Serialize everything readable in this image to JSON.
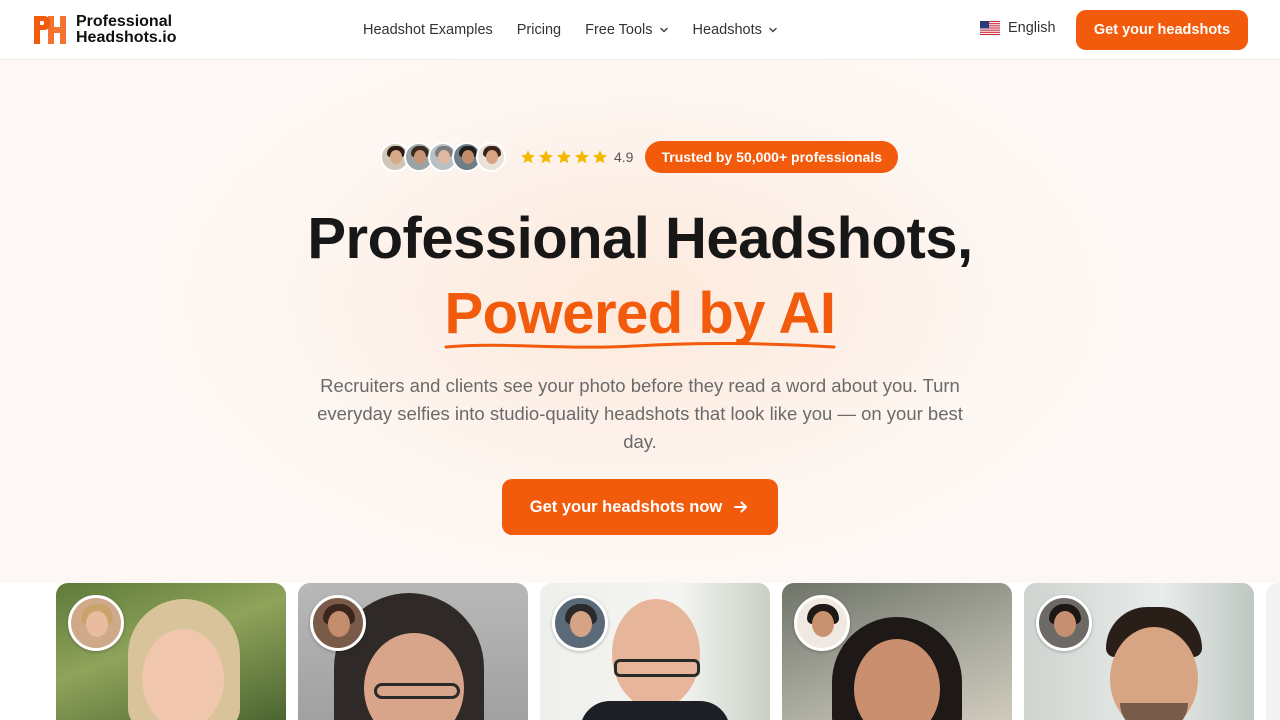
{
  "header": {
    "logo": {
      "line1": "Professional",
      "line2": "Headshots.io"
    },
    "nav": [
      {
        "label": "Headshot Examples",
        "dropdown": false
      },
      {
        "label": "Pricing",
        "dropdown": false
      },
      {
        "label": "Free Tools",
        "dropdown": true
      },
      {
        "label": "Headshots",
        "dropdown": true
      }
    ],
    "language": "English",
    "cta": "Get your headshots"
  },
  "hero": {
    "rating": "4.9",
    "stars": 5,
    "trusted_badge": "Trusted by 50,000+ professionals",
    "title_line1": "Professional Headshots,",
    "title_line2": "Powered by AI",
    "subtitle": "Recruiters and clients see your photo before they read a word about you. Turn everyday selfies into studio-quality headshots that look like you — on your best day.",
    "cta": "Get your headshots now"
  },
  "colors": {
    "accent": "#f25a0c",
    "title": "#171717",
    "subtitle": "#6a6a6a",
    "star": "#f5b800"
  },
  "icons": [
    "logo-icon",
    "us-flag-icon",
    "chevron-down-icon",
    "star-icon",
    "arrow-right-icon"
  ]
}
